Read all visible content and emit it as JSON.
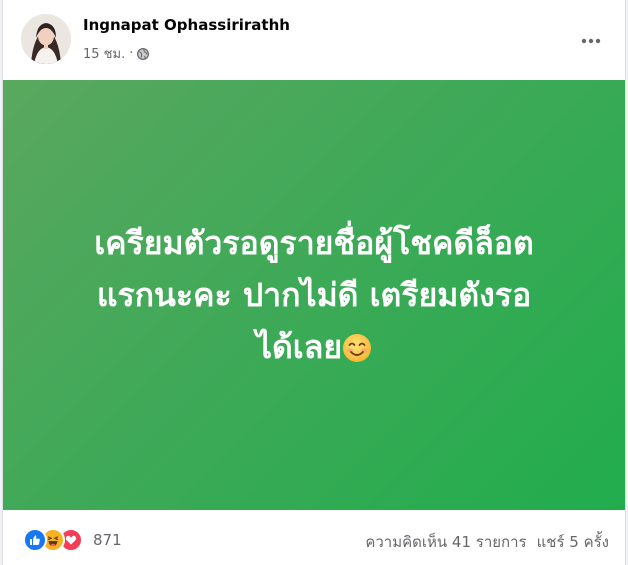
{
  "post": {
    "author": "Ingnapat Ophassirirathh",
    "time": "15 ชม.",
    "separator": "·",
    "privacy_icon": "globe-icon",
    "more_icon": "more-horizontal-icon",
    "text_lines": [
      "เครียมตัวรอดูรายชื่อผู้โชคดีล็อต",
      "แรกนะคะ ปากไม่ดี เตรียมตังรอ",
      "ได้เลย"
    ],
    "text_emoji": "smiling-face-icon",
    "background": {
      "from": "#5aa85f",
      "to": "#21ad4d"
    }
  },
  "footer": {
    "reaction_icons": [
      "like-icon",
      "haha-icon",
      "love-icon"
    ],
    "reaction_count": "871",
    "comments": "ความคิดเห็น 41 รายการ",
    "shares": "แชร์ 5 ครั้ง"
  },
  "colors": {
    "like": "#1877f2",
    "haha": "#f7b125",
    "love": "#f33e58",
    "secondary_text": "#65676b"
  }
}
